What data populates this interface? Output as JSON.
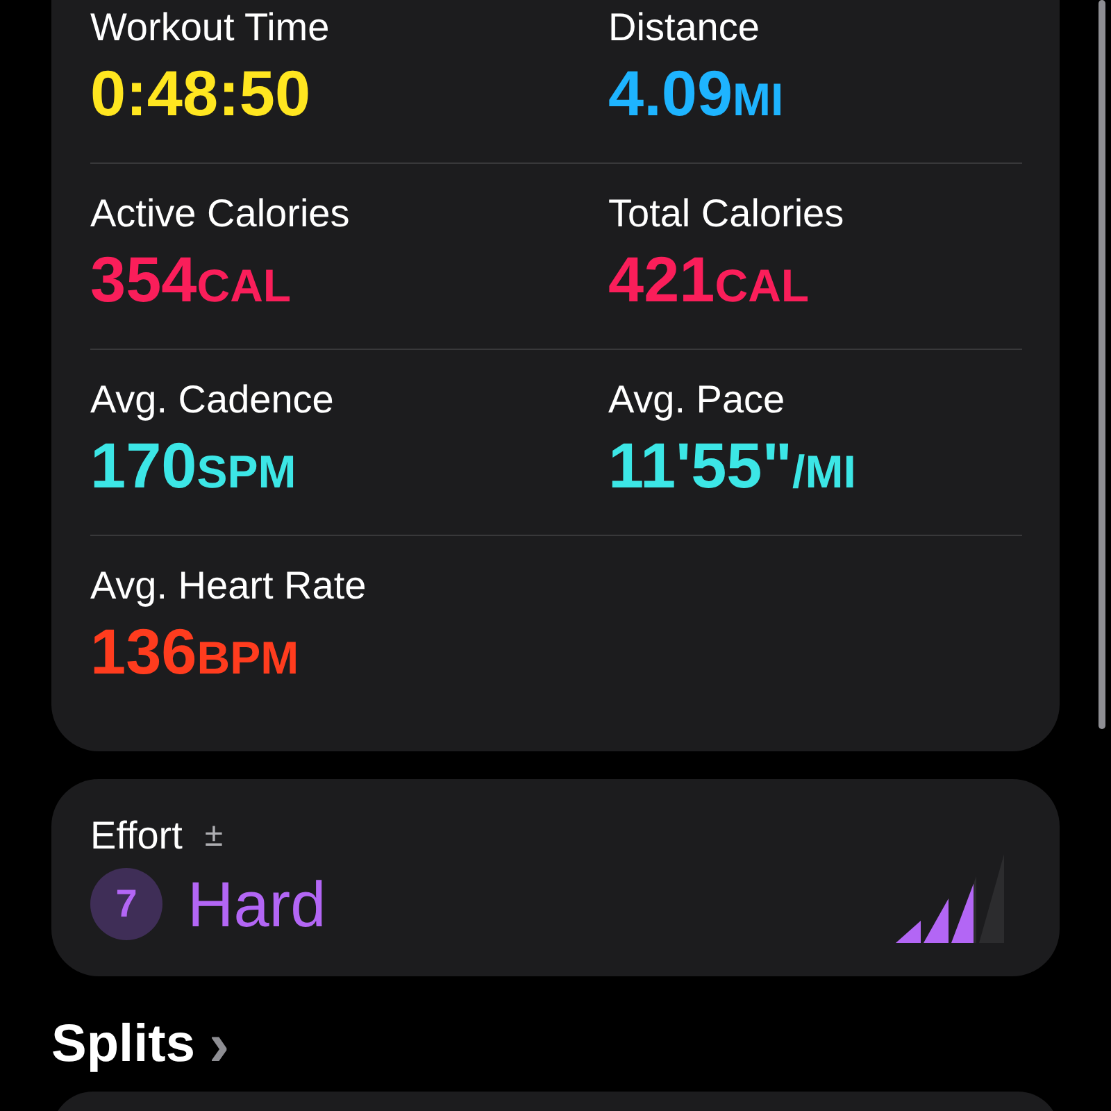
{
  "metrics": [
    {
      "label": "Workout Time",
      "value": "0:48:50",
      "color": "#ffe620"
    },
    {
      "label": "Distance",
      "value": "4.09",
      "unit": "MI",
      "color": "#1eb4ff"
    },
    {
      "label": "Active Calories",
      "value": "354",
      "unit": "CAL",
      "color": "#fa1e5a"
    },
    {
      "label": "Total Calories",
      "value": "421",
      "unit": "CAL",
      "color": "#fa1e5a"
    },
    {
      "label": "Avg. Cadence",
      "value": "170",
      "unit": "SPM",
      "color": "#3ce6e6"
    },
    {
      "label": "Avg. Pace",
      "value": "11'55\"",
      "unit": "/MI",
      "color": "#3ce6e6"
    },
    {
      "label": "Avg. Heart Rate",
      "value": "136",
      "unit": "BPM",
      "color": "#ff3c1e"
    }
  ],
  "effort": {
    "label": "Effort",
    "adjust": "±",
    "score": "7",
    "rating": "Hard"
  },
  "splits": {
    "title": "Splits",
    "chevron": "›"
  }
}
